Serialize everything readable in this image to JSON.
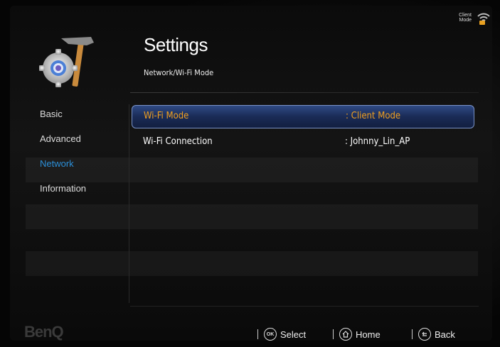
{
  "status": {
    "mode_line1": "Client",
    "mode_line2": "Mode",
    "icon": "wifi-icon"
  },
  "header": {
    "title": "Settings",
    "breadcrumb": "Network/Wi-Fi Mode",
    "icon": "settings-gear-hammer-icon"
  },
  "sidebar": {
    "items": [
      {
        "label": "Basic",
        "active": false
      },
      {
        "label": "Advanced",
        "active": false
      },
      {
        "label": "Network",
        "active": true
      },
      {
        "label": "Information",
        "active": false
      }
    ],
    "active_color": "#2b8fd8"
  },
  "main": {
    "rows": [
      {
        "label": "Wi-Fi Mode",
        "value": ": Client Mode",
        "selected": true
      },
      {
        "label": "Wi-Fi Connection",
        "value": ": Johnny_Lin_AP",
        "selected": false
      }
    ],
    "highlight_color": "#f0a020"
  },
  "footer": {
    "brand": "BenQ",
    "select_icon_text": "OK",
    "select_label": "Select",
    "home_label": "Home",
    "back_label": "Back"
  }
}
